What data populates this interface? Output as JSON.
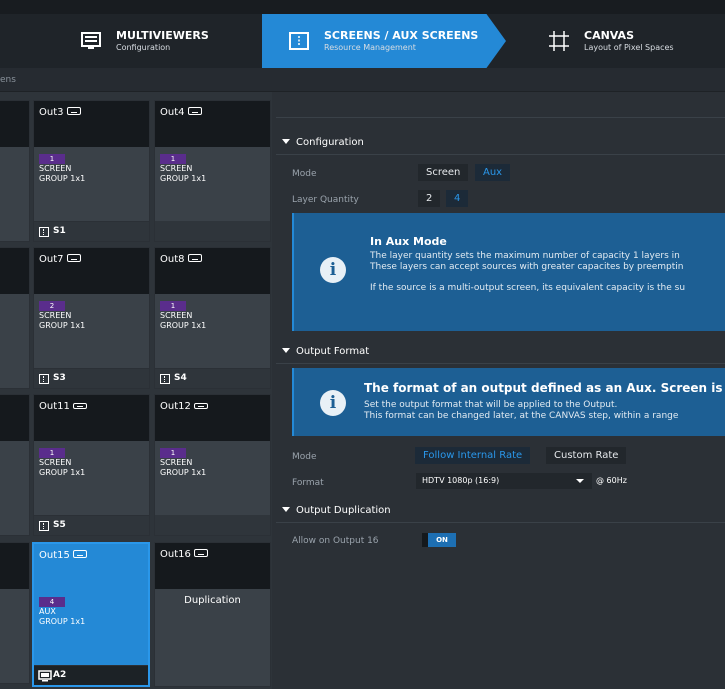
{
  "nav": {
    "items": [
      {
        "title": "MULTIVIEWERS",
        "subtitle": "Configuration"
      },
      {
        "title": "SCREENS / AUX SCREENS",
        "subtitle": "Resource Management"
      },
      {
        "title": "CANVAS",
        "subtitle": "Layout of Pixel Spaces"
      }
    ],
    "breadcrumb": "ens",
    "accent": "#2489d6"
  },
  "grid": {
    "tiles": [
      {
        "out": "Out3",
        "badge": "1",
        "kind1": "SCREEN",
        "kind2": "GROUP 1x1",
        "footer": "S1"
      },
      {
        "out": "Out4",
        "badge": "1",
        "kind1": "SCREEN",
        "kind2": "GROUP 1x1",
        "footer": ""
      },
      {
        "out": "Out7",
        "badge": "2",
        "kind1": "SCREEN",
        "kind2": "GROUP 1x1",
        "footer": "S3"
      },
      {
        "out": "Out8",
        "badge": "1",
        "kind1": "SCREEN",
        "kind2": "GROUP 1x1",
        "footer": "S4"
      },
      {
        "out": "Out11",
        "badge": "1",
        "kind1": "SCREEN",
        "kind2": "GROUP 1x1",
        "footer": "S5"
      },
      {
        "out": "Out12",
        "badge": "1",
        "kind1": "SCREEN",
        "kind2": "GROUP 1x1",
        "footer": ""
      },
      {
        "out": "Out15",
        "badge": "4",
        "kind1": "AUX",
        "kind2": "GROUP 1x1",
        "footer": "A2",
        "selected": true
      },
      {
        "out": "Out16",
        "duplication": "Duplication"
      }
    ]
  },
  "panel": {
    "configuration": {
      "title": "Configuration",
      "mode_label": "Mode",
      "mode_options": [
        "Screen",
        "Aux"
      ],
      "mode_selected": "Aux",
      "layer_label": "Layer Quantity",
      "layer_options": [
        "2",
        "4"
      ],
      "layer_selected": "4",
      "info": {
        "title": "In Aux Mode",
        "line1": "The layer quantity sets the maximum number of capacity 1 layers in",
        "line2": "These layers can accept sources with greater capacites by preemptin",
        "line3": "If the source is a multi-output screen, its equivalent capacity is the su"
      }
    },
    "output_format": {
      "title": "Output Format",
      "info": {
        "title": "The format of an output defined as an Aux. Screen is alw",
        "line1": "Set the output format that will be applied to the Output.",
        "line2": "This format can be changed later, at the CANVAS step, within a range"
      },
      "mode_label": "Mode",
      "mode_options": [
        "Follow Internal Rate",
        "Custom Rate"
      ],
      "mode_selected": "Follow Internal Rate",
      "format_label": "Format",
      "format_value": "HDTV 1080p (16:9)",
      "rate": "@ 60Hz"
    },
    "output_duplication": {
      "title": "Output Duplication",
      "allow_label": "Allow on Output 16",
      "toggle": "ON"
    }
  }
}
